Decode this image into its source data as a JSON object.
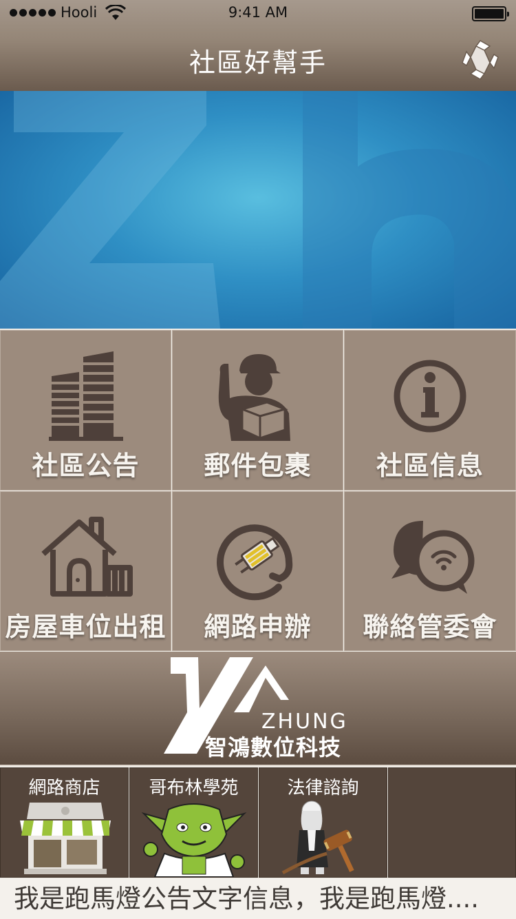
{
  "status_bar": {
    "carrier": "Hooli",
    "time": "9:41 AM"
  },
  "header": {
    "title": "社區好幫手",
    "logo_icon": "company-logo-icon"
  },
  "menu": [
    {
      "label": "社區公告",
      "icon": "buildings-icon"
    },
    {
      "label": "郵件包裹",
      "icon": "delivery-man-icon"
    },
    {
      "label": "社區信息",
      "icon": "info-icon"
    },
    {
      "label": "房屋車位出租",
      "icon": "house-icon"
    },
    {
      "label": "網路申辦",
      "icon": "plug-icon"
    },
    {
      "label": "聯絡管委會",
      "icon": "chat-bubbles-icon"
    }
  ],
  "company": {
    "name_en": "ZHUNG",
    "name_zh": "智鴻數位科技"
  },
  "shortcuts": [
    {
      "label": "網路商店",
      "icon": "storefront-icon"
    },
    {
      "label": "哥布林學苑",
      "icon": "goblin-icon"
    },
    {
      "label": "法律諮詢",
      "icon": "judge-gavel-icon"
    },
    {
      "label": "",
      "icon": ""
    }
  ],
  "marquee": {
    "text": "我是跑馬燈公告文字信息，我是跑馬燈...."
  },
  "colors": {
    "tile": "#9c8b7d",
    "icon": "#4e403a",
    "header": "#948576",
    "shortcut": "#54453b"
  }
}
